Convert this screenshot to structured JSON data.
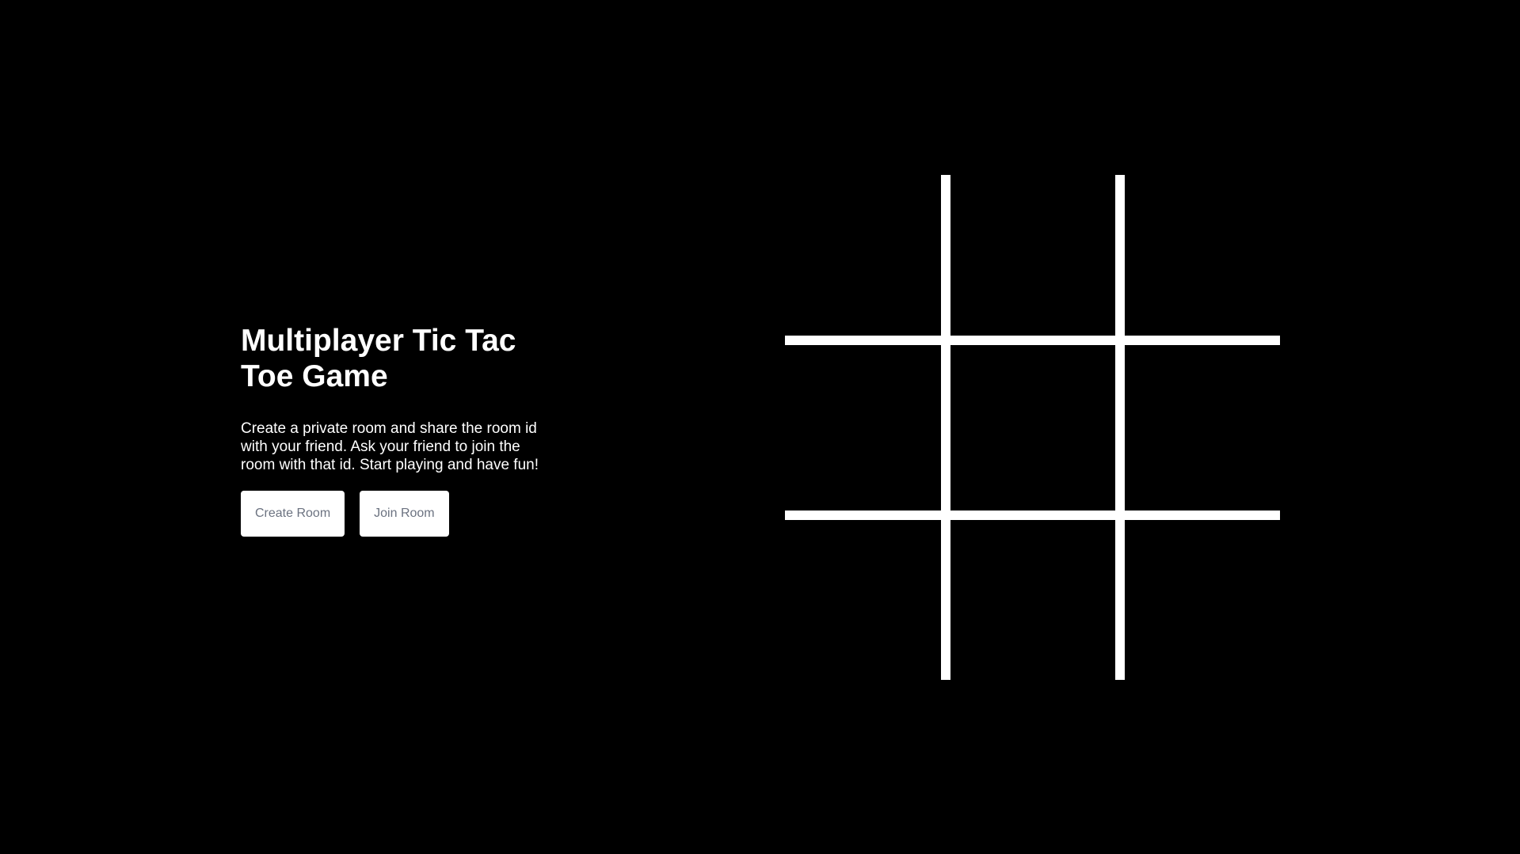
{
  "intro": {
    "title": "Multiplayer Tic Tac Toe Game",
    "description": "Create a private room and share the room id with your friend. Ask your friend to join the room with that id. Start playing and have fun!"
  },
  "actions": {
    "create_label": "Create Room",
    "join_label": "Join Room"
  },
  "colors": {
    "background": "#000000",
    "text": "#ffffff",
    "button_bg": "#ffffff",
    "button_text": "#6b7280",
    "board_lines": "#ffffff"
  }
}
